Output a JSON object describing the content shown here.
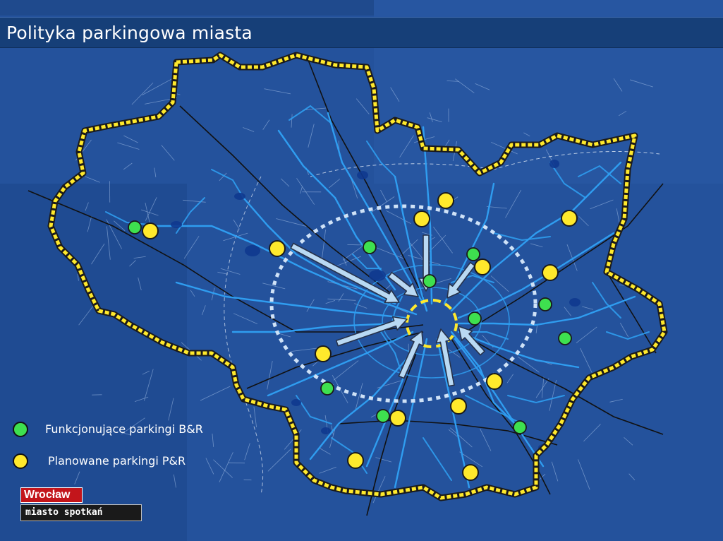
{
  "title": "Polityka parkingowa miasta",
  "colors": {
    "background": "#24529c",
    "city_border": "#ffe92c",
    "roads": "#2f9df0",
    "streets": "#a9c4ea",
    "railways": "#111111",
    "ring": "#cfe2f7",
    "arrows": "#b9d9f3",
    "br": "#3ee04f",
    "pr": "#ffe92c"
  },
  "legend": {
    "br_label": "Funkcjonujące parkingi B&R",
    "pr_label": "Planowane parkingi P&R"
  },
  "map": {
    "features": [
      "city-boundary",
      "main-roads",
      "railways",
      "outer-parking-ring",
      "city-centre-zone",
      "water-areas",
      "inflow-arrows"
    ],
    "br_parkings_count": 11,
    "pr_parkings_count": 16
  },
  "logo": {
    "top": "Wrocław",
    "bottom": "miasto spotkań"
  }
}
